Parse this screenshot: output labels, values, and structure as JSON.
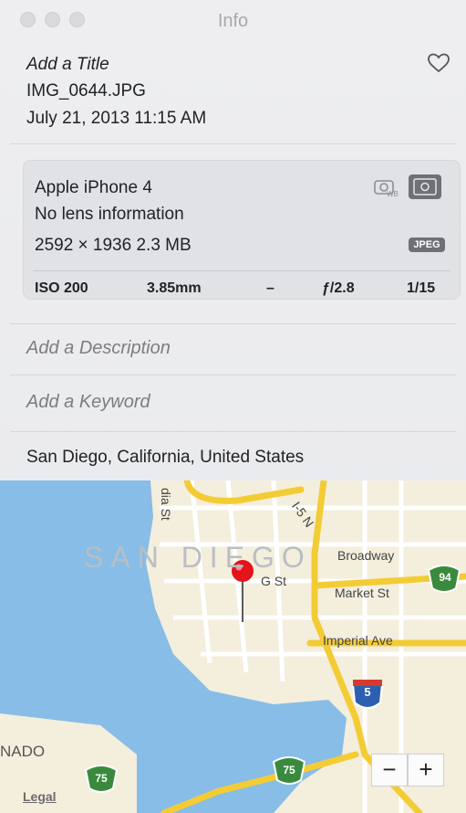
{
  "window": {
    "title": "Info"
  },
  "header": {
    "title_placeholder": "Add a Title",
    "filename": "IMG_0644.JPG",
    "datetime": "July 21, 2013   11:15 AM"
  },
  "camera": {
    "model": "Apple iPhone 4",
    "lens": "No lens information",
    "resolution_size": "2592 × 1936   2.3 MB",
    "format_badge": "JPEG",
    "exif": {
      "iso": "ISO 200",
      "focal": "3.85mm",
      "exposure_comp": "–",
      "aperture": "ƒ/2.8",
      "shutter": "1/15"
    }
  },
  "fields": {
    "description_placeholder": "Add a Description",
    "keyword_placeholder": "Add a Keyword"
  },
  "location": "San Diego, California, United States",
  "map": {
    "city_label": "SAN DIEGO",
    "labels": {
      "broadway": "Broadway",
      "market": "Market St",
      "imperial": "Imperial Ave",
      "g_st": "G St",
      "i5": "I-5 N",
      "india": "dia St",
      "coronado": "NADO"
    },
    "shields": {
      "s94": "94",
      "s75a": "75",
      "s75b": "75",
      "i5": "5"
    },
    "legal": "Legal",
    "zoom_out": "−",
    "zoom_in": "+"
  },
  "colors": {
    "water": "#87bde6",
    "land": "#f4eedd",
    "highway": "#f3cc35",
    "pin": "#e4141b"
  }
}
